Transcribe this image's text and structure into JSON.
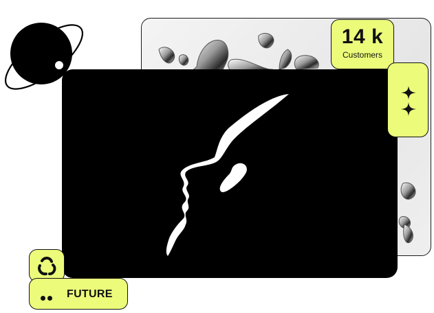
{
  "stats": {
    "value": "14 k",
    "label": "Customers"
  },
  "badge": {
    "label": "FUTURE"
  },
  "colors": {
    "accent": "#ecfc7a",
    "dark": "#000000",
    "outline": "#111111"
  },
  "icons": [
    "planet-icon",
    "sparkle-icon",
    "loop-icon",
    "dots-icon",
    "face-silhouette",
    "liquid-chrome-art"
  ]
}
